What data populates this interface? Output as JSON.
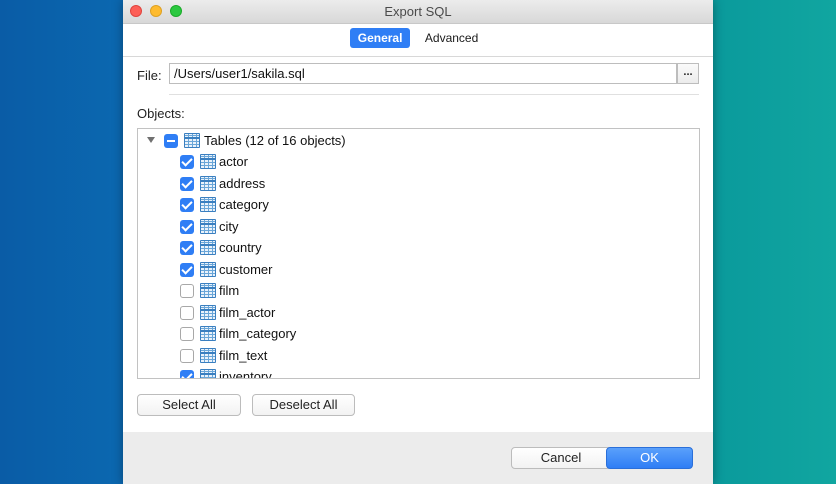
{
  "window": {
    "title": "Export SQL"
  },
  "tabs": [
    {
      "label": "General",
      "active": true
    },
    {
      "label": "Advanced",
      "active": false
    }
  ],
  "file": {
    "label": "File:",
    "value": "/Users/user1/sakila.sql",
    "browse_label": "..."
  },
  "objects": {
    "label": "Objects:",
    "root": {
      "label": "Tables (12 of 16 objects)",
      "state": "mixed",
      "icon": "table-icon"
    },
    "items": [
      {
        "label": "actor",
        "checked": true
      },
      {
        "label": "address",
        "checked": true
      },
      {
        "label": "category",
        "checked": true
      },
      {
        "label": "city",
        "checked": true
      },
      {
        "label": "country",
        "checked": true
      },
      {
        "label": "customer",
        "checked": true
      },
      {
        "label": "film",
        "checked": false
      },
      {
        "label": "film_actor",
        "checked": false
      },
      {
        "label": "film_category",
        "checked": false
      },
      {
        "label": "film_text",
        "checked": false
      },
      {
        "label": "inventory",
        "checked": true
      }
    ]
  },
  "buttons": {
    "select_all": "Select All",
    "deselect_all": "Deselect All",
    "cancel": "Cancel",
    "ok": "OK"
  },
  "colors": {
    "accent": "#2f7ef5",
    "window_bg": "#ffffff",
    "footer_bg": "#ececec"
  }
}
